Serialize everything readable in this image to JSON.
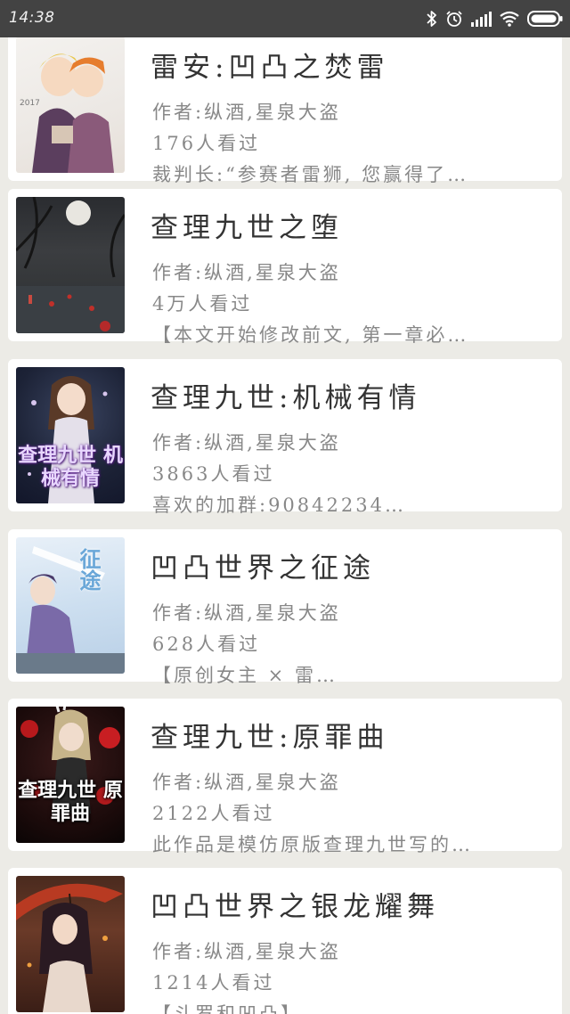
{
  "status_bar": {
    "time": "14:38",
    "icons": [
      "bluetooth-icon",
      "alarm-icon",
      "signal-icon",
      "wifi-icon",
      "battery-icon"
    ]
  },
  "books": [
    {
      "title": "雷安:凹凸之焚雷",
      "author": "作者:纵酒,星泉大盗",
      "views": "176人看过",
      "desc": "裁判长:“参赛者雷狮, 您赢得了…",
      "cover_year": "2017"
    },
    {
      "title": "查理九世之堕",
      "author": "作者:纵酒,星泉大盗",
      "views": "4万人看过",
      "desc": "【本文开始修改前文, 第一章必…"
    },
    {
      "title": "查理九世:机械有情",
      "author": "作者:纵酒,星泉大盗",
      "views": "3863人看过",
      "desc": "喜欢的加群:90842234…",
      "cover_text": "查理九世 机械有情"
    },
    {
      "title": "凹凸世界之征途",
      "author": "作者:纵酒,星泉大盗",
      "views": "628人看过",
      "desc": "【原创女主 × 雷…",
      "cover_text": "征途"
    },
    {
      "title": "查理九世:原罪曲",
      "author": "作者:纵酒,星泉大盗",
      "views": "2122人看过",
      "desc": "此作品是模仿原版查理九世写的…",
      "cover_text": "查理九世 原罪曲"
    },
    {
      "title": "凹凸世界之银龙耀舞",
      "author": "作者:纵酒,星泉大盗",
      "views": "1214人看过",
      "desc": "【斗罗和凹凸】…"
    }
  ],
  "colors": {
    "status_bar": "#434343",
    "page_background": "#ecebe6",
    "card_background": "#ffffff",
    "title_text": "#333333",
    "meta_text": "#888888"
  }
}
